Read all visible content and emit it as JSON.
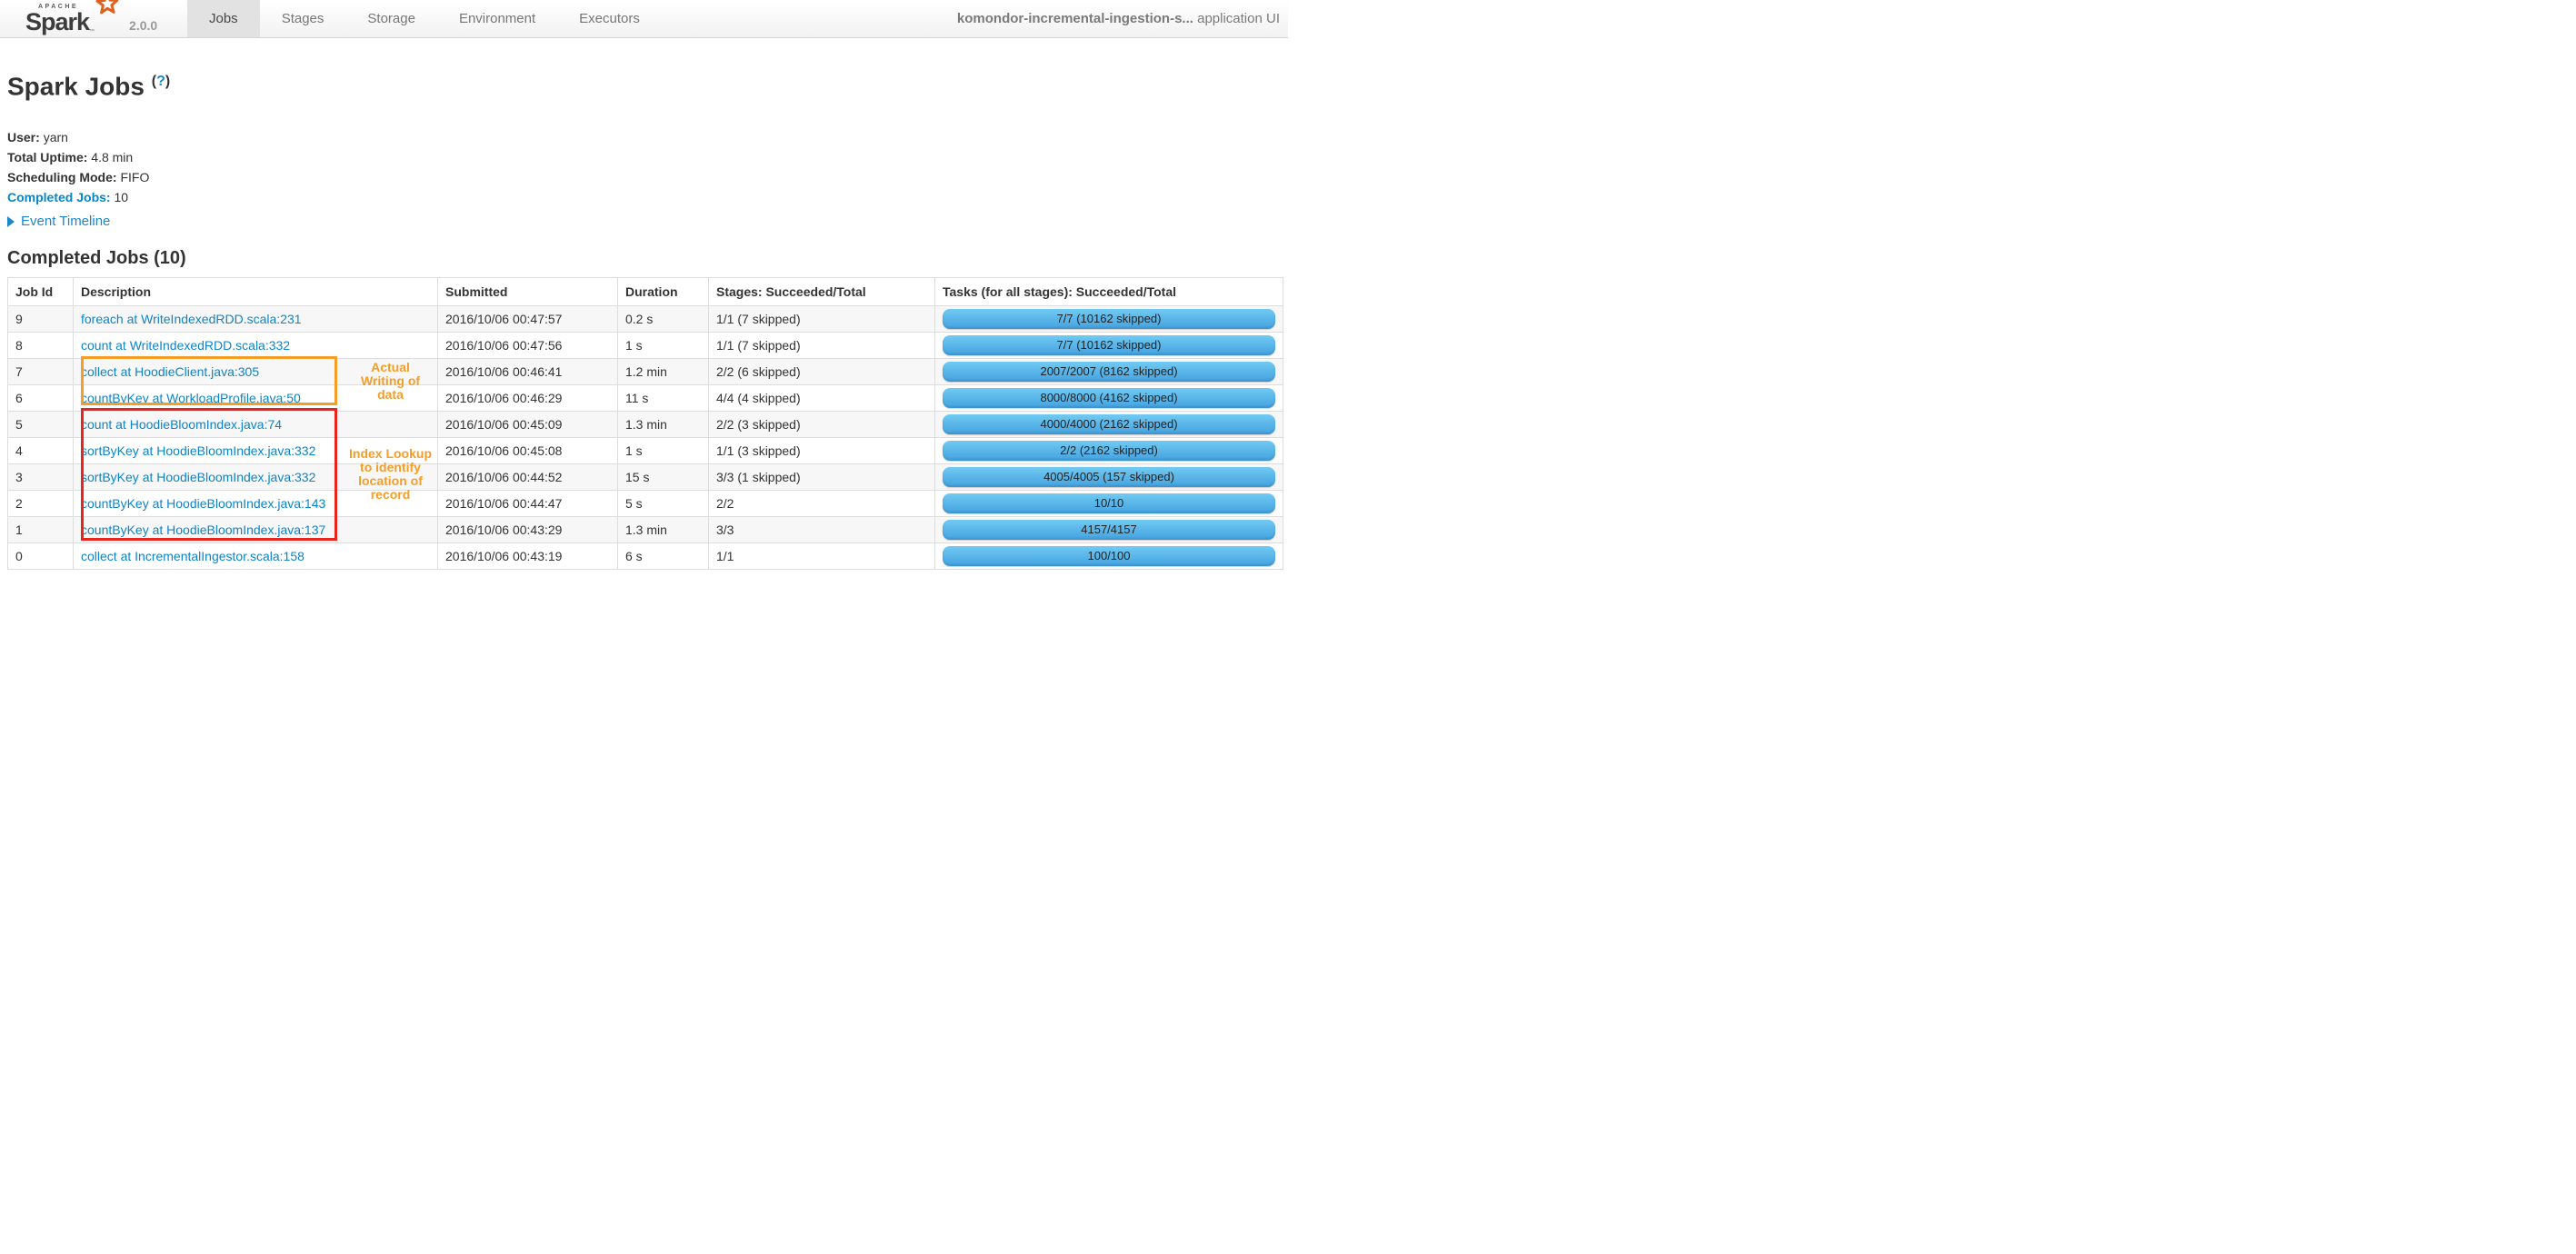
{
  "navbar": {
    "brand": {
      "apache": "APACHE",
      "name": "Spark",
      "tm": "™",
      "version": "2.0.0"
    },
    "tabs": [
      {
        "label": "Jobs",
        "active": true
      },
      {
        "label": "Stages",
        "active": false
      },
      {
        "label": "Storage",
        "active": false
      },
      {
        "label": "Environment",
        "active": false
      },
      {
        "label": "Executors",
        "active": false
      }
    ],
    "app_name": "komondor-incremental-ingestion-s...",
    "app_suffix": " application UI"
  },
  "page": {
    "title": "Spark Jobs",
    "help": {
      "open": "(",
      "q": "?",
      "close": ")"
    },
    "info": [
      {
        "label": "User:",
        "value": "yarn"
      },
      {
        "label": "Total Uptime:",
        "value": "4.8 min"
      },
      {
        "label": "Scheduling Mode:",
        "value": "FIFO"
      },
      {
        "label": "Completed Jobs:",
        "value": "10"
      }
    ],
    "event_timeline_label": "Event Timeline",
    "completed_section_title": "Completed Jobs (10)"
  },
  "table": {
    "columns": {
      "job_id": "Job Id",
      "description": "Description",
      "submitted": "Submitted",
      "duration": "Duration",
      "stages": "Stages: Succeeded/Total",
      "tasks": "Tasks (for all stages): Succeeded/Total"
    },
    "rows": [
      {
        "job_id": "9",
        "description": "foreach at WriteIndexedRDD.scala:231",
        "submitted": "2016/10/06 00:47:57",
        "duration": "0.2 s",
        "stages": "1/1 (7 skipped)",
        "tasks": "7/7 (10162 skipped)"
      },
      {
        "job_id": "8",
        "description": "count at WriteIndexedRDD.scala:332",
        "submitted": "2016/10/06 00:47:56",
        "duration": "1 s",
        "stages": "1/1 (7 skipped)",
        "tasks": "7/7 (10162 skipped)"
      },
      {
        "job_id": "7",
        "description": "collect at HoodieClient.java:305",
        "submitted": "2016/10/06 00:46:41",
        "duration": "1.2 min",
        "stages": "2/2 (6 skipped)",
        "tasks": "2007/2007 (8162 skipped)"
      },
      {
        "job_id": "6",
        "description": "countByKey at WorkloadProfile.java:50",
        "submitted": "2016/10/06 00:46:29",
        "duration": "11 s",
        "stages": "4/4 (4 skipped)",
        "tasks": "8000/8000 (4162 skipped)"
      },
      {
        "job_id": "5",
        "description": "count at HoodieBloomIndex.java:74",
        "submitted": "2016/10/06 00:45:09",
        "duration": "1.3 min",
        "stages": "2/2 (3 skipped)",
        "tasks": "4000/4000 (2162 skipped)"
      },
      {
        "job_id": "4",
        "description": "sortByKey at HoodieBloomIndex.java:332",
        "submitted": "2016/10/06 00:45:08",
        "duration": "1 s",
        "stages": "1/1 (3 skipped)",
        "tasks": "2/2 (2162 skipped)"
      },
      {
        "job_id": "3",
        "description": "sortByKey at HoodieBloomIndex.java:332",
        "submitted": "2016/10/06 00:44:52",
        "duration": "15 s",
        "stages": "3/3 (1 skipped)",
        "tasks": "4005/4005 (157 skipped)"
      },
      {
        "job_id": "2",
        "description": "countByKey at HoodieBloomIndex.java:143",
        "submitted": "2016/10/06 00:44:47",
        "duration": "5 s",
        "stages": "2/2",
        "tasks": "10/10"
      },
      {
        "job_id": "1",
        "description": "countByKey at HoodieBloomIndex.java:137",
        "submitted": "2016/10/06 00:43:29",
        "duration": "1.3 min",
        "stages": "3/3",
        "tasks": "4157/4157"
      },
      {
        "job_id": "0",
        "description": "collect at IncrementalIngestor.scala:158",
        "submitted": "2016/10/06 00:43:19",
        "duration": "6 s",
        "stages": "1/1",
        "tasks": "100/100"
      }
    ]
  },
  "annotations": {
    "writing": {
      "text": "Actual Writing of data",
      "lines": [
        "Actual",
        "Writing of",
        "data"
      ],
      "box_color": "#f59e27",
      "text_color": "#f59e27"
    },
    "index_lookup": {
      "text": "Index Lookup to identify location of record",
      "lines": [
        "Index Lookup",
        "to identify",
        "location of",
        "record"
      ],
      "box_color": "#e8251d",
      "text_color": "#f59e27"
    }
  },
  "colors": {
    "link_blue": "#0c85c8",
    "accent_blue": "#1c87c9",
    "progress_bar_top": "#70caf2",
    "progress_bar_bottom": "#44a2e0",
    "nav_active_bg": "#e2e2e2",
    "row_stripe": "#f7f7f7",
    "table_border": "#dddddd",
    "spark_star_orange": "#e0601e"
  }
}
